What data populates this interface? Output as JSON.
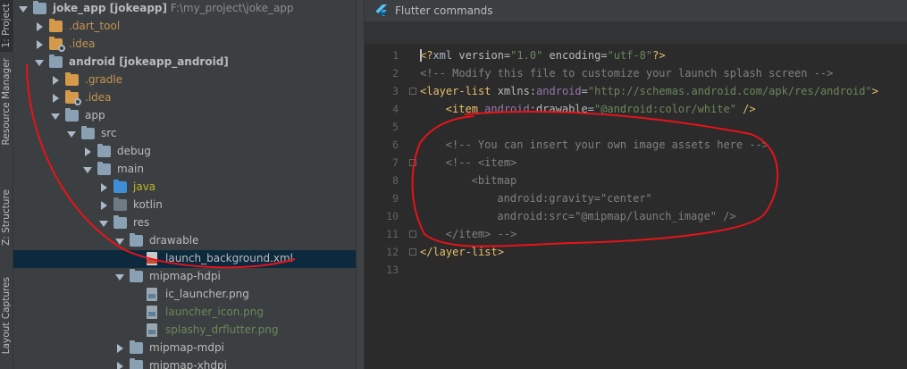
{
  "sidebar_tabs": [
    {
      "label": "1: Project"
    },
    {
      "label": "Resource Manager"
    },
    {
      "label": "Z: Structure"
    },
    {
      "label": "Layout Captures"
    }
  ],
  "tree": [
    {
      "depth": 0,
      "arrow": "open",
      "icon": "folder-module",
      "label": "joke_app [jokeapp]",
      "path": "F:\\my_project\\joke_app",
      "bold": true
    },
    {
      "depth": 1,
      "arrow": "closed",
      "icon": "folder-orange",
      "label": ".dart_tool",
      "color": "orange"
    },
    {
      "depth": 1,
      "arrow": "closed",
      "icon": "folder-gear",
      "label": ".idea",
      "color": "orange"
    },
    {
      "depth": 1,
      "arrow": "open",
      "icon": "folder-module",
      "label": "android [jokeapp_android]",
      "bold": true
    },
    {
      "depth": 2,
      "arrow": "closed",
      "icon": "folder-orange",
      "label": ".gradle",
      "color": "orange"
    },
    {
      "depth": 2,
      "arrow": "closed",
      "icon": "folder-gear",
      "label": ".idea",
      "color": "orange"
    },
    {
      "depth": 2,
      "arrow": "open",
      "icon": "folder",
      "label": "app"
    },
    {
      "depth": 3,
      "arrow": "open",
      "icon": "folder",
      "label": "src"
    },
    {
      "depth": 4,
      "arrow": "closed",
      "icon": "folder",
      "label": "debug"
    },
    {
      "depth": 4,
      "arrow": "open",
      "icon": "folder",
      "label": "main"
    },
    {
      "depth": 5,
      "arrow": "closed",
      "icon": "folder-blue",
      "label": "java",
      "color": "gold"
    },
    {
      "depth": 5,
      "arrow": "closed",
      "icon": "folder-dark",
      "label": "kotlin"
    },
    {
      "depth": 5,
      "arrow": "open",
      "icon": "folder",
      "label": "res"
    },
    {
      "depth": 6,
      "arrow": "open",
      "icon": "folder",
      "label": "drawable"
    },
    {
      "depth": 7,
      "arrow": "none",
      "icon": "file-xml",
      "label": "launch_background.xml",
      "selected": true
    },
    {
      "depth": 6,
      "arrow": "open",
      "icon": "folder",
      "label": "mipmap-hdpi"
    },
    {
      "depth": 7,
      "arrow": "none",
      "icon": "file-png",
      "label": "ic_launcher.png"
    },
    {
      "depth": 7,
      "arrow": "none",
      "icon": "file-png",
      "label": "launcher_icon.png",
      "color": "green"
    },
    {
      "depth": 7,
      "arrow": "none",
      "icon": "file-png",
      "label": "splashy_drflutter.png",
      "color": "green"
    },
    {
      "depth": 6,
      "arrow": "closed",
      "icon": "folder",
      "label": "mipmap-mdpi"
    },
    {
      "depth": 6,
      "arrow": "closed",
      "icon": "folder",
      "label": "mipmap-xhdpi"
    }
  ],
  "editor": {
    "header_title": "Flutter commands",
    "lines": [
      {
        "n": "1",
        "indent": 0,
        "tokens": [
          [
            "<?",
            "#e8bf6a"
          ],
          [
            "xml ",
            "#a9b7c6"
          ],
          [
            "version",
            "#bababa"
          ],
          [
            "=",
            "#a9b7c6"
          ],
          [
            "\"1.0\"",
            "#6a8759"
          ],
          [
            " encoding",
            "#bababa"
          ],
          [
            "=",
            "#a9b7c6"
          ],
          [
            "\"utf-8\"",
            "#6a8759"
          ],
          [
            "?>",
            "#e8bf6a"
          ]
        ]
      },
      {
        "n": "2",
        "indent": 0,
        "tokens": [
          [
            "<!-- Modify this file to customize your launch splash screen -->",
            "#808080"
          ]
        ]
      },
      {
        "n": "3",
        "indent": 0,
        "tokens": [
          [
            "<layer-list ",
            "#e8bf6a"
          ],
          [
            "xmlns:",
            "#bababa"
          ],
          [
            "android",
            "#9876aa"
          ],
          [
            "=",
            "#a9b7c6"
          ],
          [
            "\"http://schemas.android.com/apk/res/android\"",
            "#6a8759"
          ],
          [
            ">",
            "#e8bf6a"
          ]
        ]
      },
      {
        "n": "4",
        "indent": 4,
        "tokens": [
          [
            "<item ",
            "#e8bf6a"
          ],
          [
            "android",
            "#9876aa"
          ],
          [
            ":drawable",
            "#bababa"
          ],
          [
            "=",
            "#a9b7c6"
          ],
          [
            "\"@android:color/white\"",
            "#6a8759"
          ],
          [
            " />",
            "#e8bf6a"
          ]
        ]
      },
      {
        "n": "5",
        "indent": 0,
        "tokens": []
      },
      {
        "n": "6",
        "indent": 4,
        "tokens": [
          [
            "<!-- You can insert your own image assets here -->",
            "#808080"
          ]
        ]
      },
      {
        "n": "7",
        "indent": 4,
        "tokens": [
          [
            "<!-- <item>",
            "#808080"
          ]
        ]
      },
      {
        "n": "8",
        "indent": 8,
        "tokens": [
          [
            "<bitmap",
            "#808080"
          ]
        ]
      },
      {
        "n": "9",
        "indent": 12,
        "tokens": [
          [
            "android:gravity=\"center\"",
            "#808080"
          ]
        ]
      },
      {
        "n": "10",
        "indent": 12,
        "tokens": [
          [
            "android:src=\"@mipmap/launch_image\" />",
            "#808080"
          ]
        ]
      },
      {
        "n": "11",
        "indent": 4,
        "tokens": [
          [
            "</item> -->",
            "#808080"
          ]
        ]
      },
      {
        "n": "12",
        "indent": 0,
        "tokens": [
          [
            "</layer-list>",
            "#e8bf6a"
          ]
        ]
      },
      {
        "n": "13",
        "indent": 0,
        "tokens": []
      }
    ]
  }
}
